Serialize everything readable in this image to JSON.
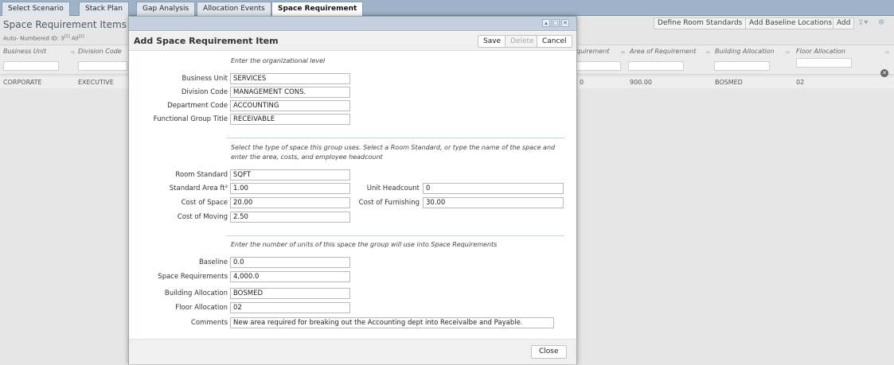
{
  "tabs": [
    "Select Scenario",
    "Stack Plan",
    "Gap Analysis",
    "Allocation Events",
    "Space Requirement"
  ],
  "background": {
    "panel_title": "Space Requirement Items for:",
    "autonum_prefix": "Auto- Numbered ID: 3",
    "autonum_sup1": "[1]",
    "autonum_all": "All",
    "autonum_sup2": "[1]",
    "actions": {
      "define_room_standards": "Define Room Standards",
      "add_baseline_locations": "Add Baseline Locations",
      "add": "Add"
    },
    "columns": [
      "Business Unit",
      "Division Code",
      "quirement",
      "Area of Requirement",
      "Building Allocation",
      "Floor Allocation"
    ],
    "row": [
      "CORPORATE",
      "EXECUTIVE",
      "0",
      "900.00",
      "BOSMED",
      "02"
    ],
    "icons": [
      "export-icon",
      "gear-icon",
      "clear-filter-icon"
    ]
  },
  "dialog": {
    "title": "Add Space Requirement Item",
    "save": "Save",
    "delete": "Delete",
    "cancel": "Cancel",
    "close": "Close",
    "section1_instr": "Enter the organizational level",
    "section2_instr": "Select the type of space this group uses. Select a Room Standard, or type the name of the space and enter the area, costs, and employee headcount",
    "section3_instr": "Enter the number of units of this space the group will use into Space Requirements",
    "fields": {
      "business_unit": {
        "label": "Business Unit",
        "value": "SERVICES"
      },
      "division_code": {
        "label": "Division Code",
        "value": "MANAGEMENT CONS."
      },
      "department_code": {
        "label": "Department Code",
        "value": "ACCOUNTING"
      },
      "functional_group_title": {
        "label": "Functional Group Title",
        "value": "RECEIVABLE"
      },
      "room_standard": {
        "label": "Room Standard",
        "value": "SQFT"
      },
      "standard_area": {
        "label": "Standard Area ft²",
        "value": "1.00"
      },
      "unit_headcount": {
        "label": "Unit Headcount",
        "value": "0"
      },
      "cost_of_space": {
        "label": "Cost of Space",
        "value": "20.00"
      },
      "cost_of_furnishing": {
        "label": "Cost of Furnishing",
        "value": "30.00"
      },
      "cost_of_moving": {
        "label": "Cost of Moving",
        "value": "2.50"
      },
      "baseline": {
        "label": "Baseline",
        "value": "0.0"
      },
      "space_requirements": {
        "label": "Space Requirements",
        "value": "4,000.0"
      },
      "building_allocation": {
        "label": "Building Allocation",
        "value": "BOSMED"
      },
      "floor_allocation": {
        "label": "Floor Allocation",
        "value": "02"
      },
      "comments": {
        "label": "Comments",
        "value": "New area required for breaking out the Accounting dept into Receivalbe and Payable."
      }
    }
  },
  "colors": {
    "tabbar": "#9fb3c8",
    "dialog_titlebar": "#c4d0dd",
    "panel": "#e6e6e6"
  }
}
